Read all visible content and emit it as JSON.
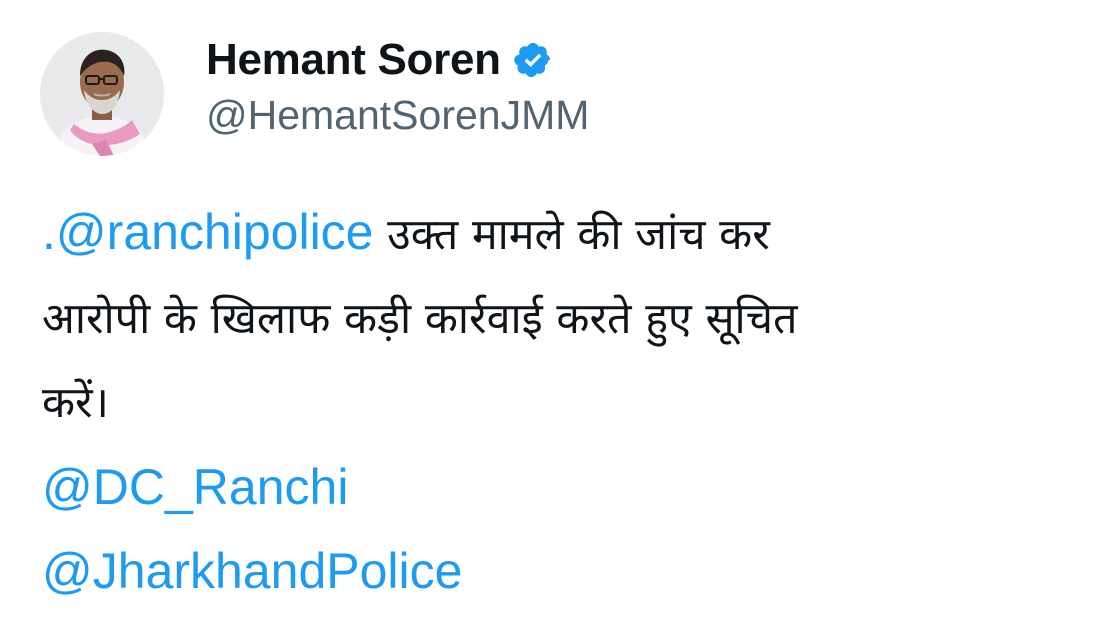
{
  "author": {
    "display_name": "Hemant Soren",
    "handle": "@HemantSorenJMM",
    "verified": true,
    "verified_icon": "verified-badge-icon"
  },
  "tweet": {
    "prefix": ".",
    "mention_1": "@ranchipolice",
    "line_1_text": " उक्त मामले की जांच कर",
    "line_2_text": "आरोपी के खिलाफ कड़ी कार्रवाई करते हुए सूचित",
    "line_3_text": "करें।",
    "mention_2": "@DC_Ranchi",
    "mention_3": "@JharkhandPolice"
  },
  "colors": {
    "text": "#0f1419",
    "secondary": "#536471",
    "link": "#1d9bf0",
    "background": "#ffffff"
  }
}
